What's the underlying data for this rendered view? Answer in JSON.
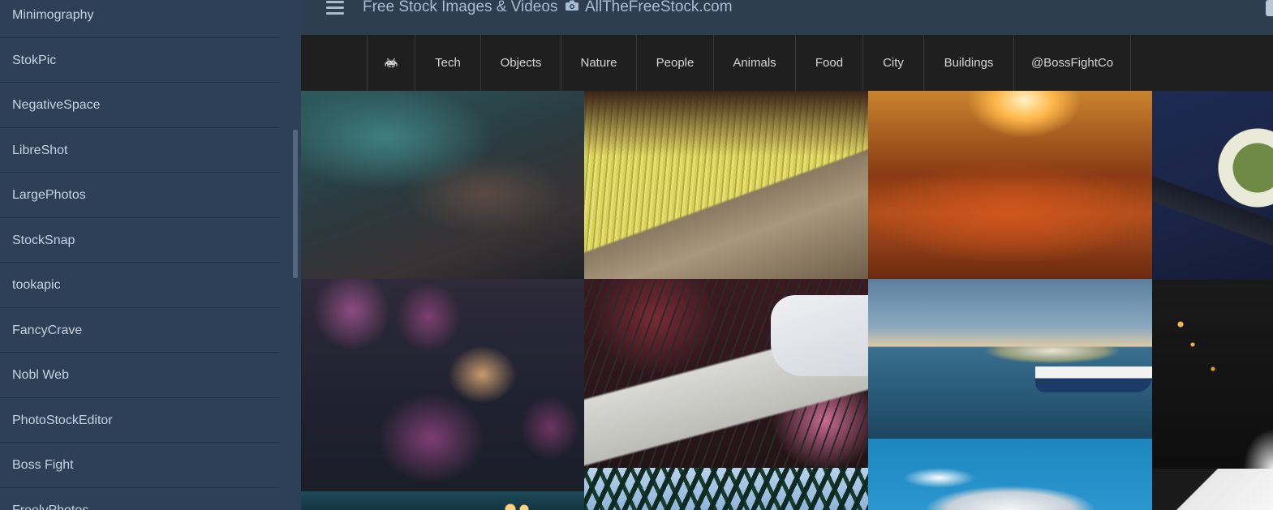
{
  "header": {
    "title": "Free Stock Images & Videos",
    "site": "AllTheFreeStock.com"
  },
  "sidebar": {
    "items": [
      {
        "label": "Minimography"
      },
      {
        "label": "StokPic"
      },
      {
        "label": "NegativeSpace"
      },
      {
        "label": "LibreShot"
      },
      {
        "label": "LargePhotos"
      },
      {
        "label": "StockSnap"
      },
      {
        "label": "tookapic"
      },
      {
        "label": "FancyCrave"
      },
      {
        "label": "Nobl Web"
      },
      {
        "label": "PhotoStockEditor"
      },
      {
        "label": "Boss Fight"
      },
      {
        "label": "FreelyPhotos"
      }
    ]
  },
  "nav": {
    "logo_icon": "space-invader-icon",
    "items": [
      {
        "label": "Tech"
      },
      {
        "label": "Objects"
      },
      {
        "label": "Nature"
      },
      {
        "label": "People"
      },
      {
        "label": "Animals"
      },
      {
        "label": "Food"
      },
      {
        "label": "City"
      },
      {
        "label": "Buildings"
      },
      {
        "label": "@BossFightCo"
      }
    ]
  },
  "colors": {
    "sidebar_bg": "#2e4056",
    "header_bg": "#2c3e50",
    "nav_bg": "#1f1f1f",
    "text_light": "#c5d3e2"
  },
  "gallery": {
    "photos": [
      {
        "subject": "aerial-mountains-teal"
      },
      {
        "subject": "yellow-brush-bristles"
      },
      {
        "subject": "autumn-leaves-sunset"
      },
      {
        "subject": "coffee-cup-blue"
      },
      {
        "subject": "purple-leaves"
      },
      {
        "subject": "keyboard-player"
      },
      {
        "subject": "harbor-boat-town"
      },
      {
        "subject": "dark-lights"
      },
      {
        "subject": "night-lights-teal"
      },
      {
        "subject": "palm-trees-sky"
      },
      {
        "subject": "snowy-mountain-peak"
      },
      {
        "subject": "white-grey-abstract"
      }
    ]
  }
}
